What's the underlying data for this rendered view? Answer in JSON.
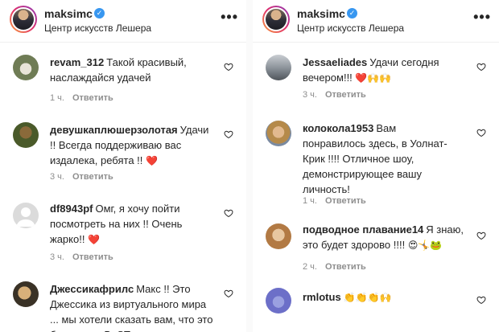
{
  "left": {
    "header": {
      "username": "maksimc",
      "location": "Центр искусств Лешера"
    },
    "comments": [
      {
        "user": "revam_312",
        "text": "Такой красивый, наслаждайся удачей",
        "emoji": "",
        "time": "1 ч.",
        "reply": "Ответить"
      },
      {
        "user": "девушкаплюшерзолотая",
        "text": "Удачи !! Всегда поддерживаю вас издалека, ребята !!",
        "emoji": "❤️",
        "time": "3 ч.",
        "reply": "Ответить"
      },
      {
        "user": "df8943pf",
        "text": "Омг, я хочу пойти посмотреть на них !! Очень жарко!!",
        "emoji": "❤️",
        "time": "3 ч.",
        "reply": "Ответить"
      },
      {
        "user": "Джессикафрилс",
        "text": "Макс !! Это Джессика из виртуального мира ... мы хотели сказать вам, что это было наш. BeST",
        "emoji": "",
        "time": "",
        "reply": ""
      }
    ]
  },
  "right": {
    "header": {
      "username": "maksimc",
      "location": "Центр искусств Лешера"
    },
    "comments": [
      {
        "user": "Jessaeliades",
        "text": "Удачи сегодня вечером!!!",
        "emoji": "❤️🙌🙌",
        "time": "3 ч.",
        "reply": "Ответить"
      },
      {
        "user": "колокола1953",
        "text": "Вам понравилось здесь, в Уолнат-Крик !!!! Отличное шоу, демонстрирующее вашу личность!",
        "emoji": "",
        "time": "1 ч.",
        "reply": "Ответить"
      },
      {
        "user": "подводное плавание14",
        "text": "Я знаю, это будет здорово !!!!",
        "emoji": "😍🤸🐸",
        "time": "2 ч.",
        "reply": "Ответить"
      },
      {
        "user": "rmlotus",
        "text": "",
        "emoji": "👏👏👏🙌",
        "time": "",
        "reply": ""
      }
    ]
  },
  "icons": {
    "verified": "verified-badge-icon",
    "more": "more-options-icon",
    "like": "heart-outline-icon"
  },
  "colors": {
    "accent": "#3897f0",
    "heart": "#ed4956",
    "muted": "#8e8e8e",
    "text": "#262626"
  }
}
